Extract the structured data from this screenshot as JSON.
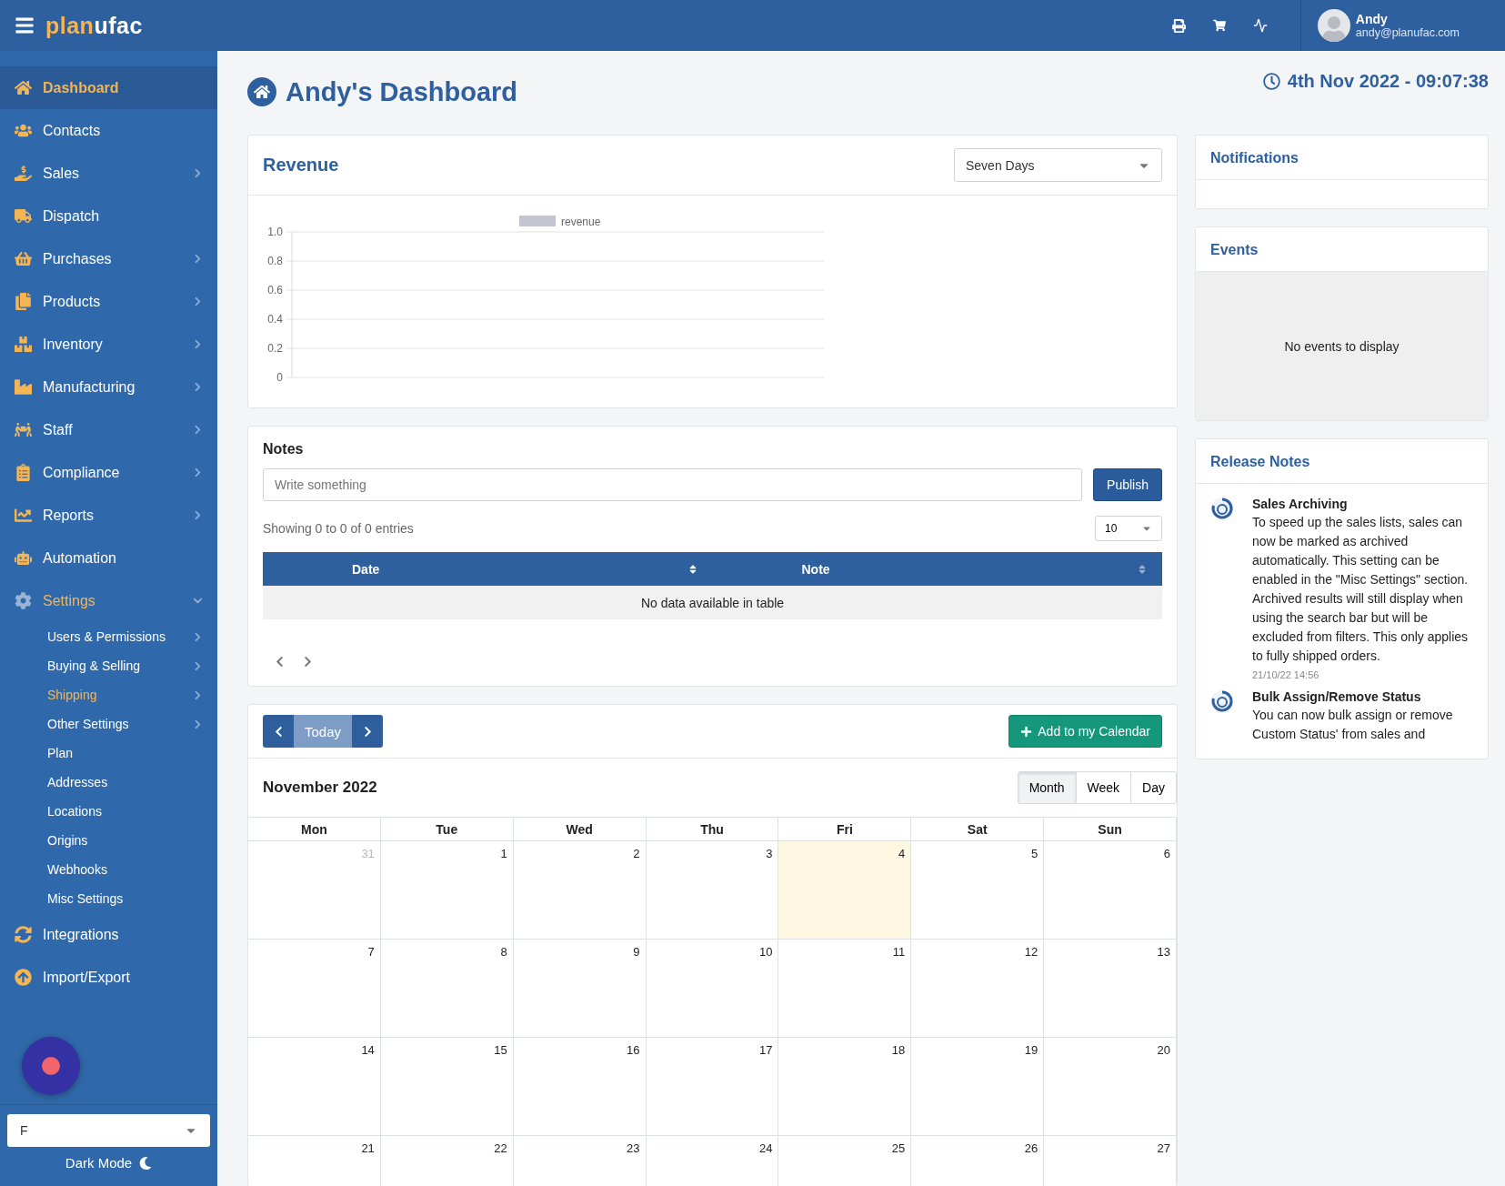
{
  "topbar": {
    "logo": {
      "first": "plan",
      "second": "ufac"
    },
    "user": {
      "name": "Andy",
      "email": "andy@planufac.com"
    }
  },
  "sidebar": {
    "items": [
      {
        "label": "Dashboard",
        "selected": true,
        "submenu": false,
        "expanded": false
      },
      {
        "label": "Contacts",
        "selected": false,
        "submenu": false,
        "expanded": false
      },
      {
        "label": "Sales",
        "selected": false,
        "submenu": true,
        "expanded": false
      },
      {
        "label": "Dispatch",
        "selected": false,
        "submenu": false,
        "expanded": false
      },
      {
        "label": "Purchases",
        "selected": false,
        "submenu": true,
        "expanded": false
      },
      {
        "label": "Products",
        "selected": false,
        "submenu": true,
        "expanded": false
      },
      {
        "label": "Inventory",
        "selected": false,
        "submenu": true,
        "expanded": false
      },
      {
        "label": "Manufacturing",
        "selected": false,
        "submenu": true,
        "expanded": false
      },
      {
        "label": "Staff",
        "selected": false,
        "submenu": true,
        "expanded": false
      },
      {
        "label": "Compliance",
        "selected": false,
        "submenu": true,
        "expanded": false
      },
      {
        "label": "Reports",
        "selected": false,
        "submenu": true,
        "expanded": false
      },
      {
        "label": "Automation",
        "selected": false,
        "submenu": false,
        "expanded": false
      },
      {
        "label": "Settings",
        "selected": false,
        "submenu": true,
        "expanded": true,
        "children": [
          {
            "label": "Users & Permissions",
            "selected": false,
            "submenu": true
          },
          {
            "label": "Buying & Selling",
            "selected": false,
            "submenu": true
          },
          {
            "label": "Shipping",
            "selected": true,
            "submenu": true
          },
          {
            "label": "Other Settings",
            "selected": false,
            "submenu": true
          },
          {
            "label": "Plan",
            "selected": false,
            "submenu": false
          },
          {
            "label": "Addresses",
            "selected": false,
            "submenu": false
          },
          {
            "label": "Locations",
            "selected": false,
            "submenu": false
          },
          {
            "label": "Origins",
            "selected": false,
            "submenu": false
          },
          {
            "label": "Webhooks",
            "selected": false,
            "submenu": false
          },
          {
            "label": "Misc Settings",
            "selected": false,
            "submenu": false
          }
        ]
      },
      {
        "label": "Integrations",
        "selected": false,
        "submenu": false,
        "expanded": false
      },
      {
        "label": "Import/Export",
        "selected": false,
        "submenu": false,
        "expanded": false
      }
    ],
    "select_value": "F",
    "dark_mode": "Dark Mode"
  },
  "page": {
    "title": "Andy's Dashboard",
    "datetime": "4th Nov 2022 - 09:07:38"
  },
  "revenue": {
    "title": "Revenue",
    "period": "Seven Days",
    "chart_data": {
      "type": "bar",
      "series": [
        {
          "name": "revenue",
          "color": "#c3c6d1"
        }
      ],
      "ylim": [
        0,
        1
      ],
      "yticks": [
        0,
        0.2,
        0.4,
        0.6,
        0.8,
        {
          "value": 1,
          "label": "1.0"
        }
      ],
      "grid": true
    }
  },
  "notes": {
    "title": "Notes",
    "placeholder": "Write something",
    "publish": "Publish",
    "info": "Showing 0 to 0 of 0 entries",
    "page_size": "10",
    "columns": [
      "Date",
      "Note"
    ],
    "empty": "No data available in table"
  },
  "calendar": {
    "today": "Today",
    "today_disabled": true,
    "add": "Add to my Calendar",
    "month_title": "November 2022",
    "views": [
      {
        "label": "Month",
        "selected": true
      },
      {
        "label": "Week",
        "selected": false
      },
      {
        "label": "Day",
        "selected": false
      }
    ],
    "weekdays": [
      "Mon",
      "Tue",
      "Wed",
      "Thu",
      "Fri",
      "Sat",
      "Sun"
    ],
    "weeks": [
      [
        {
          "day": "31",
          "muted": true,
          "today": false
        },
        {
          "day": "1",
          "muted": false,
          "today": false
        },
        {
          "day": "2",
          "muted": false,
          "today": false
        },
        {
          "day": "3",
          "muted": false,
          "today": false
        },
        {
          "day": "4",
          "muted": false,
          "today": true
        },
        {
          "day": "5",
          "muted": false,
          "today": false
        },
        {
          "day": "6",
          "muted": false,
          "today": false
        }
      ],
      [
        {
          "day": "7",
          "muted": false,
          "today": false
        },
        {
          "day": "8",
          "muted": false,
          "today": false
        },
        {
          "day": "9",
          "muted": false,
          "today": false
        },
        {
          "day": "10",
          "muted": false,
          "today": false
        },
        {
          "day": "11",
          "muted": false,
          "today": false
        },
        {
          "day": "12",
          "muted": false,
          "today": false
        },
        {
          "day": "13",
          "muted": false,
          "today": false
        }
      ],
      [
        {
          "day": "14",
          "muted": false,
          "today": false
        },
        {
          "day": "15",
          "muted": false,
          "today": false
        },
        {
          "day": "16",
          "muted": false,
          "today": false
        },
        {
          "day": "17",
          "muted": false,
          "today": false
        },
        {
          "day": "18",
          "muted": false,
          "today": false
        },
        {
          "day": "19",
          "muted": false,
          "today": false
        },
        {
          "day": "20",
          "muted": false,
          "today": false
        }
      ],
      [
        {
          "day": "21",
          "muted": false,
          "today": false
        },
        {
          "day": "22",
          "muted": false,
          "today": false
        },
        {
          "day": "23",
          "muted": false,
          "today": false
        },
        {
          "day": "24",
          "muted": false,
          "today": false
        },
        {
          "day": "25",
          "muted": false,
          "today": false
        },
        {
          "day": "26",
          "muted": false,
          "today": false
        },
        {
          "day": "27",
          "muted": false,
          "today": false
        }
      ]
    ]
  },
  "notifications": {
    "title": "Notifications"
  },
  "events": {
    "title": "Events",
    "empty": "No events to display"
  },
  "release_notes": {
    "title": "Release Notes",
    "items": [
      {
        "title": "Sales Archiving",
        "body": "To speed up the sales lists, sales can now be marked as archived automatically. This setting can be enabled in the \"Misc Settings\" section. Archived results will still display when using the search bar but will be excluded from filters. This only applies to fully shipped orders.",
        "date": "21/10/22 14:56"
      },
      {
        "title": "Bulk Assign/Remove Status",
        "body": "You can now bulk assign or remove Custom Status' from sales and"
      }
    ]
  }
}
